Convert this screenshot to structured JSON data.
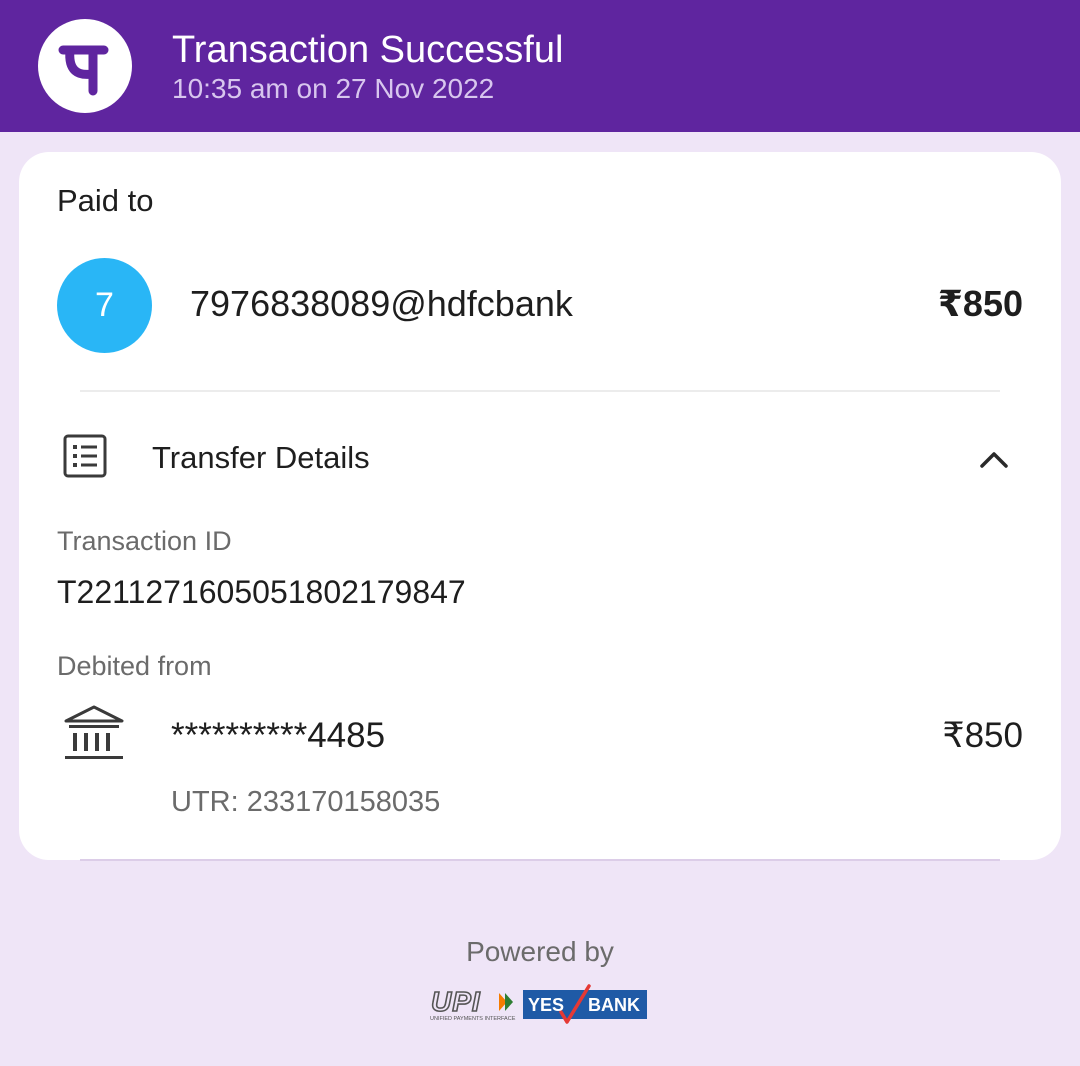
{
  "header": {
    "logo_icon": "phonepe-logo-icon",
    "title": "Transaction Successful",
    "subtitle": "10:35 am on 27 Nov 2022"
  },
  "paid_to": {
    "label": "Paid to",
    "avatar_letter": "7",
    "payee": "7976838089@hdfcbank",
    "amount": "₹850"
  },
  "transfer_details": {
    "icon": "receipt-list-icon",
    "title": "Transfer Details",
    "toggle_icon": "chevron-up-icon",
    "transaction_id_label": "Transaction ID",
    "transaction_id": "T2211271605051802179847",
    "debited_from_label": "Debited from",
    "bank_icon": "bank-icon",
    "account": "**********4485",
    "amount": "₹850",
    "utr": "UTR: 233170158035"
  },
  "footer": {
    "powered_by": "Powered by",
    "upi_logo": "upi-logo",
    "upi_text": "UPI",
    "upi_tagline": "UNIFIED PAYMENTS INTERFACE",
    "bank_logo": "yes-bank-logo",
    "yes_text": "YES",
    "bank_text": "BANK"
  },
  "colors": {
    "header_bg": "#5f259f",
    "page_bg": "#efe5f7",
    "avatar_bg": "#29b6f6",
    "yes_bank_blue": "#1f5aa6",
    "yes_bank_red": "#e53935"
  }
}
